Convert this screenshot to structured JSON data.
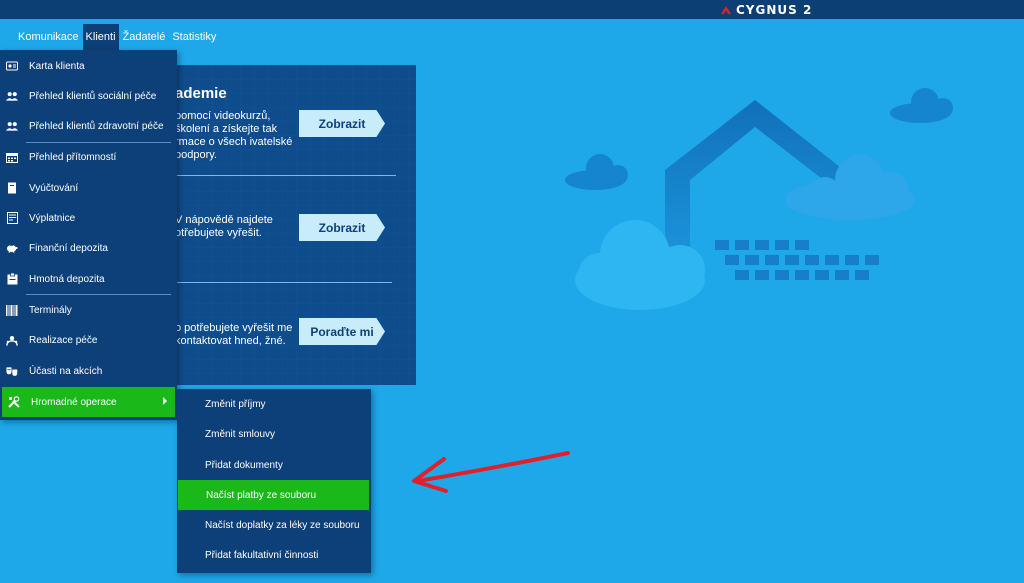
{
  "app": {
    "logo_text": "CYGNUS 2"
  },
  "nav": {
    "tabs": [
      {
        "label": "Komunikace"
      },
      {
        "label": "Klienti"
      },
      {
        "label": "Žadatelé"
      },
      {
        "label": "Statistiky"
      }
    ],
    "active_tab": "Klienti"
  },
  "panel": {
    "title": "ademie",
    "block1_text": "pomocí videokurzů, školení a získejte tak rmace o všech ivatelské podpory.",
    "block2_text": "V nápovědě najdete otřebujete vyřešit.",
    "block3_text": "o potřebujete vyřešit me kontaktovat hned, žné.",
    "btn1": "Zobrazit",
    "btn2": "Zobrazit",
    "btn3": "Poraďte mi"
  },
  "menu": {
    "items": [
      {
        "label": "Karta klienta",
        "icon": "id-card-icon"
      },
      {
        "label": "Přehled klientů sociální péče",
        "icon": "users-icon"
      },
      {
        "label": "Přehled klientů zdravotní péče",
        "icon": "users-icon"
      },
      {
        "label": "Přehled přítomností",
        "icon": "calendar-icon"
      },
      {
        "label": "Vyúčtování",
        "icon": "book-icon"
      },
      {
        "label": "Výplatnice",
        "icon": "document-icon"
      },
      {
        "label": "Finanční depozita",
        "icon": "piggy-bank-icon"
      },
      {
        "label": "Hmotná depozita",
        "icon": "clipboard-icon"
      },
      {
        "label": "Terminály",
        "icon": "barcode-icon"
      },
      {
        "label": "Realizace péče",
        "icon": "care-icon"
      },
      {
        "label": "Účasti na akcích",
        "icon": "masks-icon"
      },
      {
        "label": "Hromadné operace",
        "icon": "tools-icon"
      }
    ],
    "highlighted": "Hromadné operace"
  },
  "submenu": {
    "items": [
      {
        "label": "Změnit příjmy"
      },
      {
        "label": "Změnit smlouvy"
      },
      {
        "label": "Přidat dokumenty"
      },
      {
        "label": "Načíst platby ze souboru"
      },
      {
        "label": "Načíst doplatky za léky ze souboru"
      },
      {
        "label": "Přidat fakultativní činnosti"
      }
    ],
    "highlighted": "Načíst platby ze souboru"
  },
  "colors": {
    "background": "#1ea8ea",
    "menu_bg": "#0d3f78",
    "highlight": "#1bb81a",
    "annotation_arrow": "#e0202a",
    "logo_accent": "#e0202a"
  }
}
